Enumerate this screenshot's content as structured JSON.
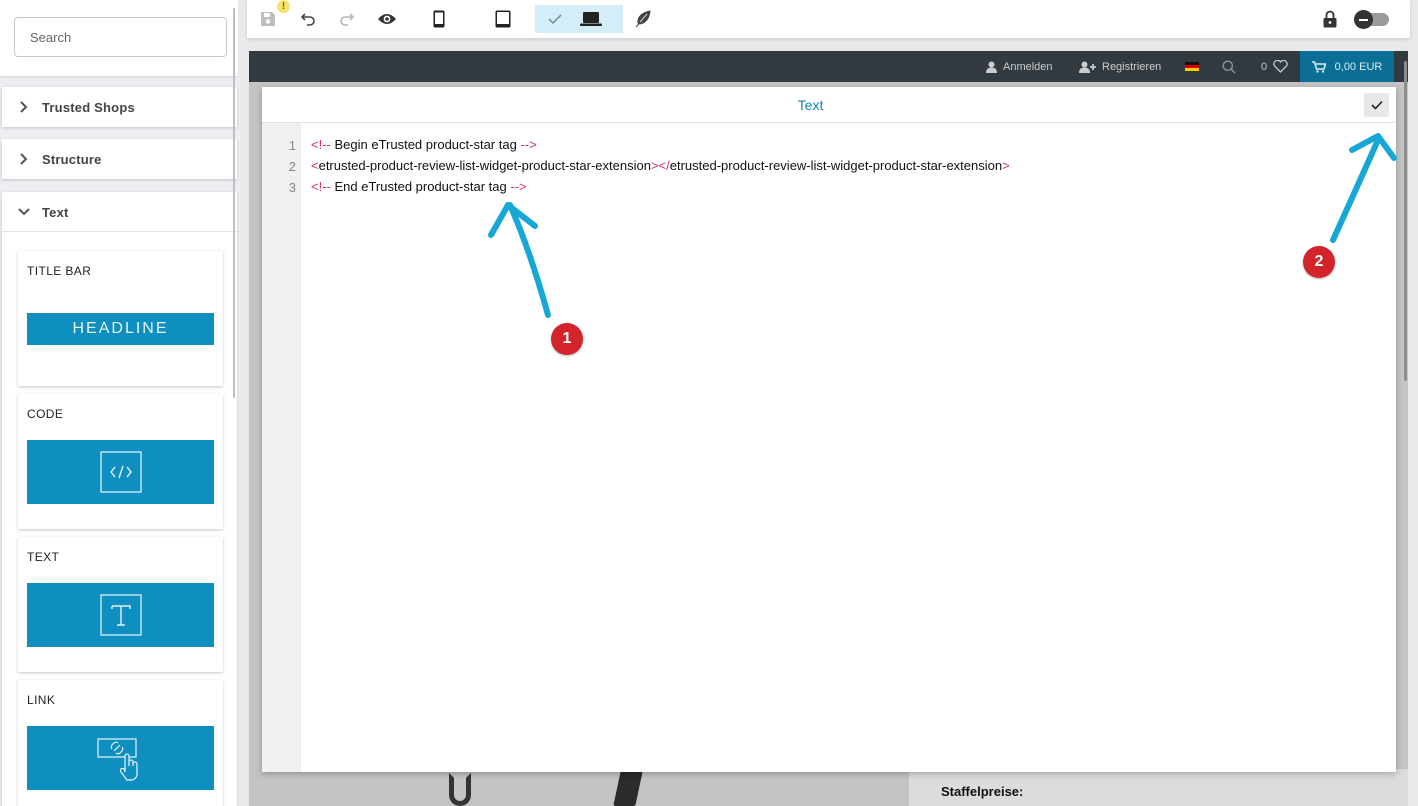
{
  "sidebar": {
    "search": {
      "placeholder": "Search",
      "value": ""
    },
    "sections": [
      {
        "label": "Trusted Shops",
        "expanded": false
      },
      {
        "label": "Structure",
        "expanded": false
      },
      {
        "label": "Text",
        "expanded": true
      }
    ],
    "widgets": [
      {
        "title": "TITLE BAR",
        "preview_text": "HEADLINE",
        "icon": "headline-icon"
      },
      {
        "title": "CODE",
        "icon": "code-icon"
      },
      {
        "title": "TEXT",
        "icon": "text-t-icon"
      },
      {
        "title": "LINK",
        "icon": "link-hand-icon"
      }
    ]
  },
  "toolbar": {
    "icons": [
      "save-icon",
      "undo-icon",
      "redo-icon",
      "eye-icon",
      "mobile-icon",
      "tablet-icon",
      "check-icon",
      "laptop-icon",
      "feather-icon",
      "lock-icon"
    ],
    "warning_badge": "!",
    "active_view": "desktop",
    "accent_color": "#d4eef7"
  },
  "shop": {
    "header": {
      "login": "Anmelden",
      "register": "Registrieren",
      "wishlist_count": "0",
      "cart_total": "0,00 EUR"
    },
    "staffelpreise": "Staffelpreise:"
  },
  "editor": {
    "title": "Text",
    "line_numbers": [
      "1",
      "2",
      "3"
    ],
    "lines": [
      [
        {
          "cls": "tk-cmt",
          "t": "<!-- "
        },
        {
          "cls": "tk-txt",
          "t": "Begin eTrusted product-star tag"
        },
        {
          "cls": "tk-cmt",
          "t": " -->"
        }
      ],
      [
        {
          "cls": "tk-cmt",
          "t": "<"
        },
        {
          "cls": "tk-txt",
          "t": "etrusted-product-review-list-widget-product-star-extension"
        },
        {
          "cls": "tk-cmt",
          "t": "></"
        },
        {
          "cls": "tk-txt",
          "t": "etrusted-product-review-list-widget-product-star-extension"
        },
        {
          "cls": "tk-cmt",
          "t": ">"
        }
      ],
      [
        {
          "cls": "tk-cmt",
          "t": "<!-- "
        },
        {
          "cls": "tk-txt",
          "t": "End eTrusted product-star tag"
        },
        {
          "cls": "tk-cmt",
          "t": " -->"
        }
      ]
    ]
  },
  "annotations": {
    "markers": [
      "1",
      "2"
    ],
    "arrow_color": "#17a7d6",
    "marker_color": "#d3232b"
  }
}
